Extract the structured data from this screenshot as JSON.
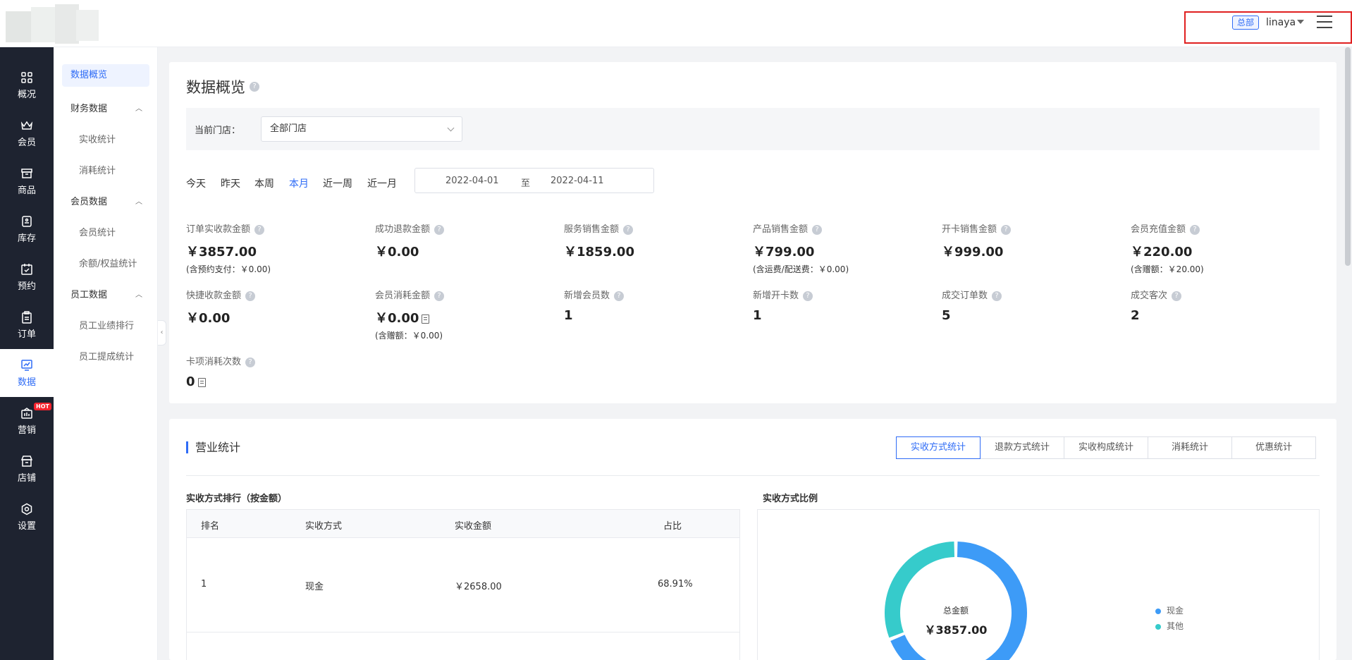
{
  "header": {
    "hq_badge": "总部",
    "username": "linaya"
  },
  "sidebar": {
    "items": [
      {
        "label": "概况",
        "icon": "grid-icon"
      },
      {
        "label": "会员",
        "icon": "crown-icon"
      },
      {
        "label": "商品",
        "icon": "store-box-icon"
      },
      {
        "label": "库存",
        "icon": "inventory-icon"
      },
      {
        "label": "预约",
        "icon": "calendar-check-icon"
      },
      {
        "label": "订单",
        "icon": "clipboard-icon"
      },
      {
        "label": "数据",
        "icon": "chart-icon"
      },
      {
        "label": "营销",
        "icon": "marketing-icon",
        "badge": "HOT"
      },
      {
        "label": "店铺",
        "icon": "shop-icon"
      },
      {
        "label": "设置",
        "icon": "settings-icon"
      }
    ],
    "active": "数据"
  },
  "submenu": {
    "active": "数据概览",
    "groups": [
      {
        "label": "财务数据",
        "items": [
          "实收统计",
          "消耗统计"
        ]
      },
      {
        "label": "会员数据",
        "items": [
          "会员统计",
          "余额/权益统计"
        ]
      },
      {
        "label": "员工数据",
        "items": [
          "员工业绩排行",
          "员工提成统计"
        ]
      }
    ]
  },
  "overview": {
    "title": "数据概览",
    "store_label": "当前门店：",
    "store_value": "全部门店",
    "ranges": [
      "今天",
      "昨天",
      "本周",
      "本月",
      "近一周",
      "近一月"
    ],
    "active_range": "本月",
    "date_start": "2022-04-01",
    "date_sep": "至",
    "date_end": "2022-04-11",
    "stats": [
      {
        "label": "订单实收款金额",
        "value": "￥3857.00",
        "sub": "(含预约支付：￥0.00)"
      },
      {
        "label": "成功退款金额",
        "value": "￥0.00"
      },
      {
        "label": "服务销售金额",
        "value": "￥1859.00"
      },
      {
        "label": "产品销售金额",
        "value": "￥799.00",
        "sub": "(含运费/配送费：￥0.00)"
      },
      {
        "label": "开卡销售金额",
        "value": "￥999.00"
      },
      {
        "label": "会员充值金额",
        "value": "￥220.00",
        "sub": "(含赠额：￥20.00)"
      },
      {
        "label": "快捷收款金额",
        "value": "￥0.00"
      },
      {
        "label": "会员消耗金额",
        "value": "￥0.00",
        "sub": "(含赠额：￥0.00)"
      },
      {
        "label": "新增会员数",
        "value": "1"
      },
      {
        "label": "新增开卡数",
        "value": "1"
      },
      {
        "label": "成交订单数",
        "value": "5"
      },
      {
        "label": "成交客次",
        "value": "2"
      },
      {
        "label": "卡项消耗次数",
        "value": "0"
      }
    ]
  },
  "business": {
    "title": "营业统计",
    "tabs": [
      "实收方式统计",
      "退款方式统计",
      "实收构成统计",
      "消耗统计",
      "优惠统计"
    ],
    "active_tab": "实收方式统计",
    "table_title": "实收方式排行（按金额）",
    "columns": [
      "排名",
      "实收方式",
      "实收金额",
      "占比"
    ],
    "rows": [
      {
        "rank": "1",
        "method": "现金",
        "amount": "￥2658.00",
        "ratio": "68.91%"
      }
    ],
    "chart_title": "实收方式比例",
    "total_label": "总金额",
    "total_value": "￥3857.00"
  },
  "chart_data": {
    "type": "pie",
    "title": "实收方式比例",
    "categories": [
      "现金",
      "其他"
    ],
    "values": [
      2658.0,
      1199.0
    ],
    "colors": [
      "#3d9bf7",
      "#36cbcb"
    ],
    "legend_position": "right"
  }
}
